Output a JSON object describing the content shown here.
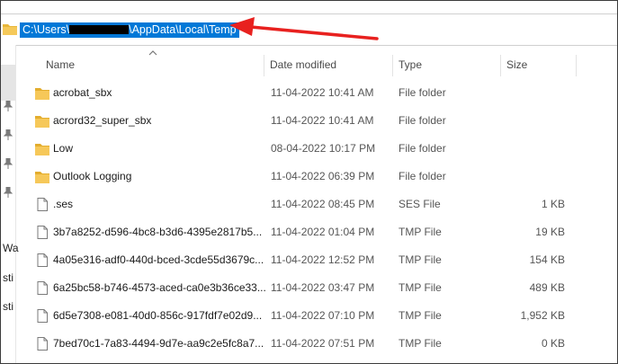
{
  "address": {
    "path_prefix": "C:\\Users\\",
    "path_suffix": "\\AppData\\Local\\Temp"
  },
  "columns": {
    "name": "Name",
    "date": "Date modified",
    "type": "Type",
    "size": "Size"
  },
  "nav": {
    "partial_1": "Wa",
    "partial_2": "sti",
    "partial_3": "sti"
  },
  "files": [
    {
      "name": "acrobat_sbx",
      "date": "11-04-2022 10:41 AM",
      "type": "File folder",
      "size": "",
      "icon": "folder-icon"
    },
    {
      "name": "acrord32_super_sbx",
      "date": "11-04-2022 10:41 AM",
      "type": "File folder",
      "size": "",
      "icon": "folder-icon"
    },
    {
      "name": "Low",
      "date": "08-04-2022 10:17 PM",
      "type": "File folder",
      "size": "",
      "icon": "folder-icon"
    },
    {
      "name": "Outlook Logging",
      "date": "11-04-2022 06:39 PM",
      "type": "File folder",
      "size": "",
      "icon": "folder-icon"
    },
    {
      "name": ".ses",
      "date": "11-04-2022 08:45 PM",
      "type": "SES File",
      "size": "1 KB",
      "icon": "file-icon"
    },
    {
      "name": "3b7a8252-d596-4bc8-b3d6-4395e2817b5...",
      "date": "11-04-2022 01:04 PM",
      "type": "TMP File",
      "size": "19 KB",
      "icon": "file-icon"
    },
    {
      "name": "4a05e316-adf0-440d-bced-3cde55d3679c...",
      "date": "11-04-2022 12:52 PM",
      "type": "TMP File",
      "size": "154 KB",
      "icon": "file-icon"
    },
    {
      "name": "6a25bc58-b746-4573-aced-ca0e3b36ce33...",
      "date": "11-04-2022 03:47 PM",
      "type": "TMP File",
      "size": "489 KB",
      "icon": "file-icon"
    },
    {
      "name": "6d5e7308-e081-40d0-856c-917fdf7e02d9...",
      "date": "11-04-2022 07:10 PM",
      "type": "TMP File",
      "size": "1,952 KB",
      "icon": "file-icon"
    },
    {
      "name": "7bed70c1-7a83-4494-9d7e-aa9c2e5fc8a7...",
      "date": "11-04-2022 07:51 PM",
      "type": "TMP File",
      "size": "0 KB",
      "icon": "file-icon"
    }
  ],
  "colors": {
    "selection": "#0078d7",
    "arrow": "#e8211f",
    "folder": "#f0c04a"
  }
}
